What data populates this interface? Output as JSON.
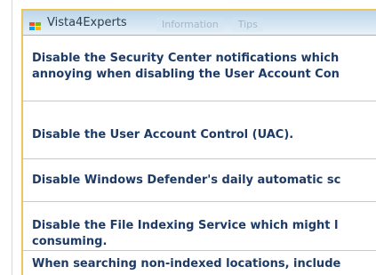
{
  "window": {
    "title": "Vista4Experts",
    "tabs": [
      "Information",
      "Tips"
    ]
  },
  "items": [
    {
      "line1": "Disable the Security Center notifications which",
      "line2": "annoying when disabling the User Account Con"
    },
    {
      "line1": "Disable the User Account Control (UAC)."
    },
    {
      "line1": "Disable Windows Defender's daily automatic sc"
    },
    {
      "line1": "Disable the File Indexing Service which might l",
      "line2": "consuming."
    },
    {
      "line1": "When searching non-indexed locations, include"
    }
  ],
  "colors": {
    "frame": "#f0c45d",
    "text": "#1e3b66"
  }
}
